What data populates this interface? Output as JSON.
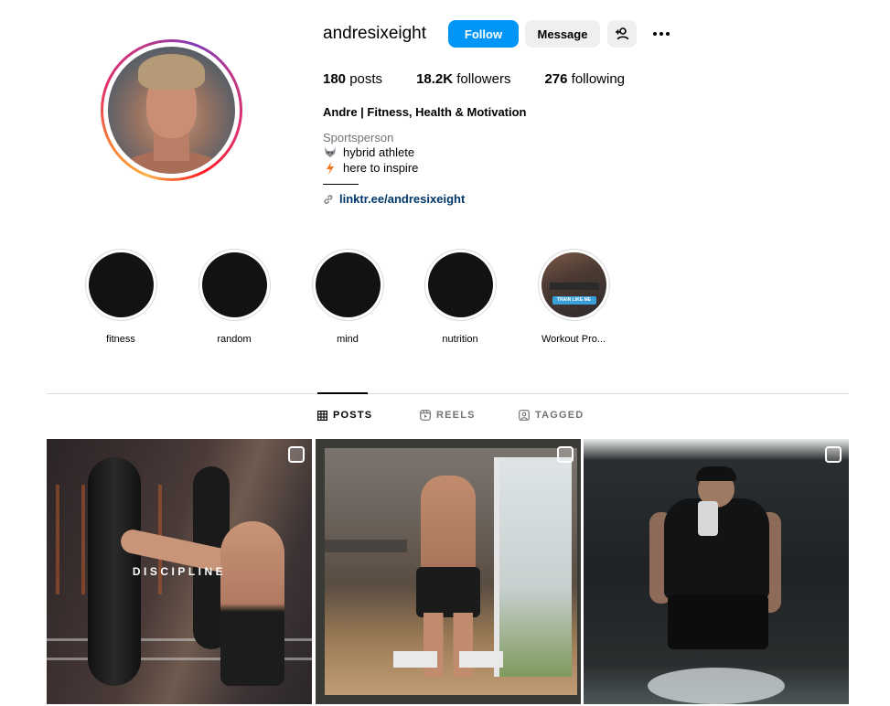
{
  "profile": {
    "username": "andresixeight",
    "follow_label": "Follow",
    "message_label": "Message",
    "stats": {
      "posts_count": "180",
      "posts_label": "posts",
      "followers_count": "18.2K",
      "followers_label": "followers",
      "following_count": "276",
      "following_label": "following"
    },
    "full_name": "Andre | Fitness, Health & Motivation",
    "category": "Sportsperson",
    "bio": [
      {
        "icon": "wolf-emoji",
        "text": "hybrid athlete"
      },
      {
        "icon": "lightning-emoji",
        "text": "here to inspire"
      }
    ],
    "link": "linktr.ee/andresixeight"
  },
  "highlights": [
    {
      "label": "fitness"
    },
    {
      "label": "random"
    },
    {
      "label": "mind"
    },
    {
      "label": "nutrition"
    },
    {
      "label": "Workout Pro...",
      "cover_text": "TRAIN LIKE ME"
    }
  ],
  "tabs": [
    {
      "label": "POSTS",
      "icon": "grid-icon",
      "active": true
    },
    {
      "label": "REELS",
      "icon": "reels-icon",
      "active": false
    },
    {
      "label": "TAGGED",
      "icon": "tagged-icon",
      "active": false
    }
  ],
  "posts": [
    {
      "overlay_text": "DISCIPLINE",
      "type": "reel"
    },
    {
      "overlay_text": "",
      "type": "carousel"
    },
    {
      "overlay_text": "",
      "type": "carousel"
    }
  ],
  "colors": {
    "follow_button": "#0095f6",
    "secondary_button": "#efefef",
    "link": "#00376b"
  }
}
